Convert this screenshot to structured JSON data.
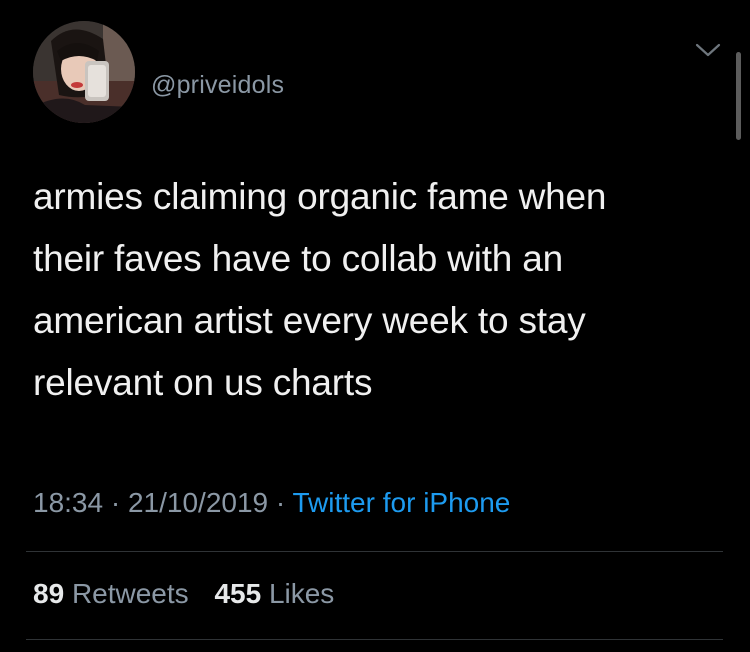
{
  "tweet": {
    "handle": "@priveidols",
    "text": "armies claiming organic fame when\ntheir faves have to collab with an\namerican artist every week to stay\nrelevant on us charts",
    "time": "18:34",
    "separator": "·",
    "date": "21/10/2019",
    "source": "Twitter for iPhone",
    "retweets_count": "89",
    "retweets_label": "Retweets",
    "likes_count": "455",
    "likes_label": "Likes"
  },
  "icons": {
    "menu": "chevron-down-icon"
  },
  "colors": {
    "background": "#000000",
    "text": "#e7e9ea",
    "secondary": "#8b98a5",
    "link": "#1d9bf0",
    "divider": "#2f3336"
  }
}
